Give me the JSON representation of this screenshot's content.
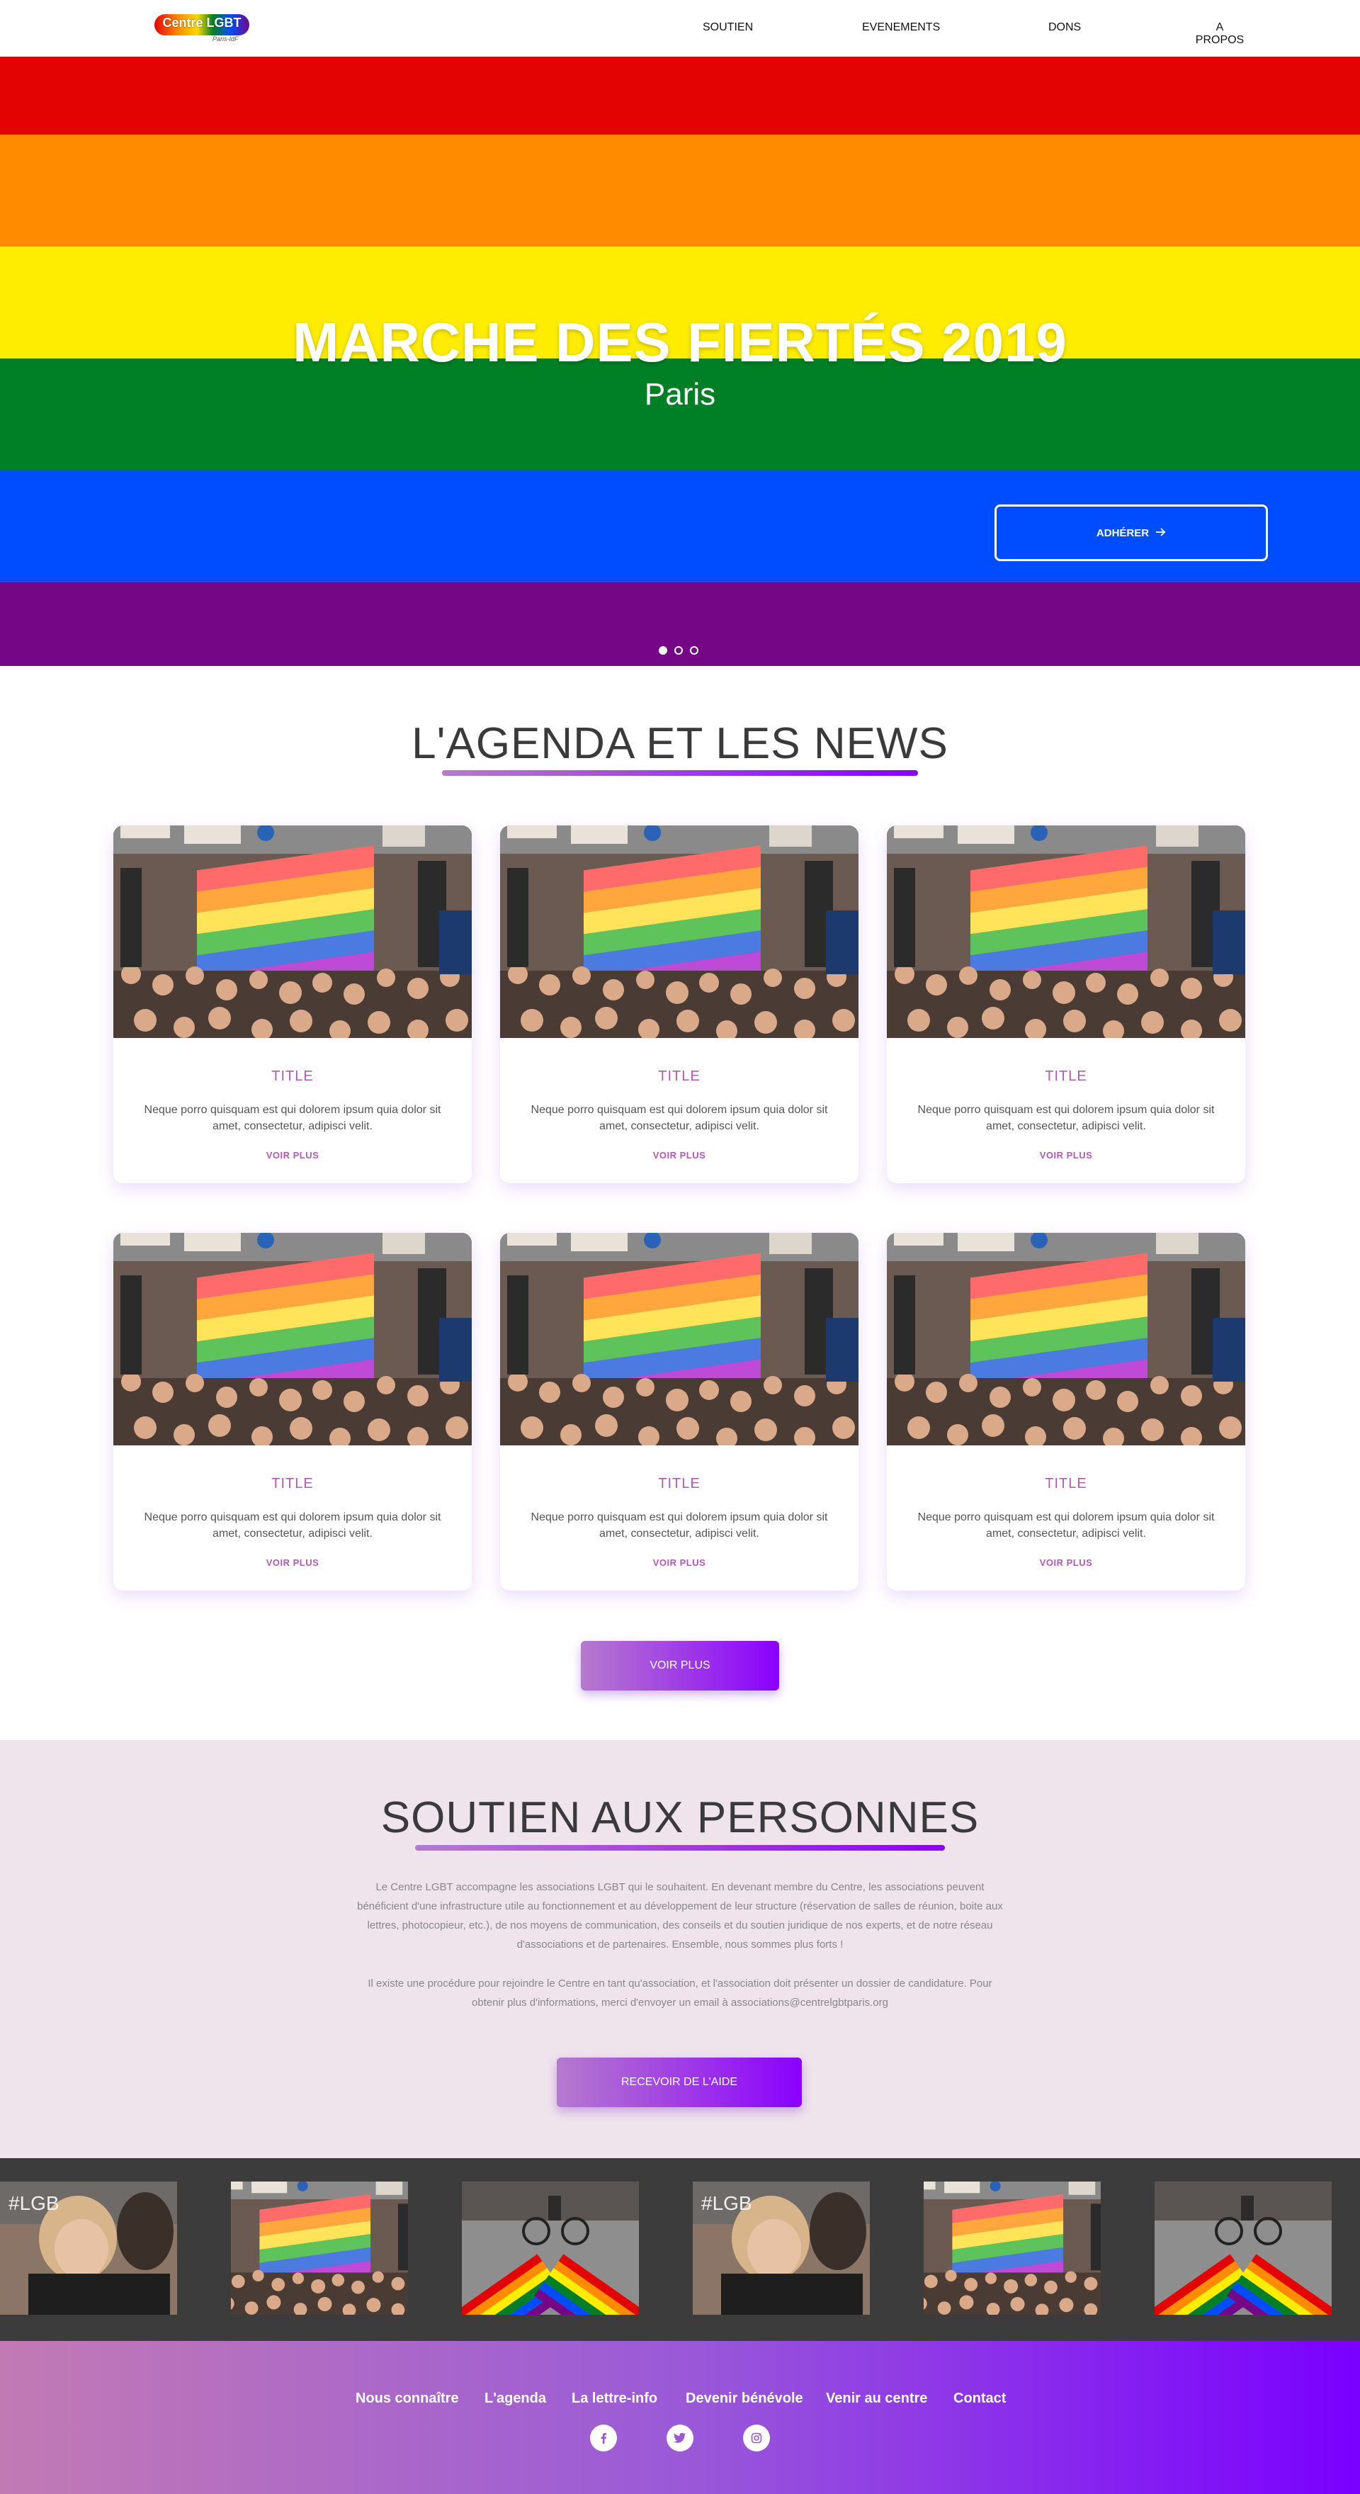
{
  "brand": {
    "logo_text": "Centre LGBT",
    "logo_sub": "Paris-IdF"
  },
  "nav": {
    "items": [
      "SOUTIEN",
      "EVENEMENTS",
      "DONS",
      "A PROPOS"
    ]
  },
  "hero": {
    "title": "MARCHE DES FIERTÉS 2019",
    "subtitle": "Paris",
    "cta_label": "ADHÉRER",
    "cta_icon": "arrow-right-icon",
    "stripe_colors": [
      "#e40303",
      "#ff8c00",
      "#ffed00",
      "#008026",
      "#004dff",
      "#750787"
    ],
    "active_slide": 1,
    "slide_count": 3
  },
  "agenda": {
    "title": "L'AGENDA ET LES NEWS",
    "cards": [
      {
        "title": "TITLE",
        "text": "Neque porro quisquam est qui dolorem ipsum quia dolor sit amet, consectetur, adipisci velit.",
        "link": "VOIR PLUS"
      },
      {
        "title": "TITLE",
        "text": "Neque porro quisquam est qui dolorem ipsum quia dolor sit amet, consectetur, adipisci velit.",
        "link": "VOIR PLUS"
      },
      {
        "title": "TITLE",
        "text": "Neque porro quisquam est qui dolorem ipsum quia dolor sit amet, consectetur, adipisci velit.",
        "link": "VOIR PLUS"
      },
      {
        "title": "TITLE",
        "text": "Neque porro quisquam est qui dolorem ipsum quia dolor sit amet, consectetur, adipisci velit.",
        "link": "VOIR PLUS"
      },
      {
        "title": "TITLE",
        "text": "Neque porro quisquam est qui dolorem ipsum quia dolor sit amet, consectetur, adipisci velit.",
        "link": "VOIR PLUS"
      },
      {
        "title": "TITLE",
        "text": "Neque porro quisquam est qui dolorem ipsum quia dolor sit amet, consectetur, adipisci velit.",
        "link": "VOIR PLUS"
      }
    ],
    "more_label": "VOIR PLUS"
  },
  "support": {
    "title": "SOUTIEN AUX PERSONNES",
    "paragraph1": "Le Centre LGBT accompagne les associations LGBT qui le souhaitent. En devenant membre du Centre, les associations peuvent bénéficient d'une infrastructure utile au fonctionnement et au développement de leur structure (réservation de salles de réunion, boite aux lettres, photocopieur, etc.), de nos moyens de communication, des conseils et du soutien juridique de nos experts, et de notre réseau d'associations et de partenaires. Ensemble, nous sommes plus forts !",
    "paragraph2": "Il existe une procédure pour rejoindre le Centre en tant qu'association, et l'association doit présenter un dossier de candidature. Pour obtenir plus d'informations, merci d'envoyer un email à associations@centrelgbtparis.org",
    "cta_label": "RECEVOIR DE L'AIDE"
  },
  "gallery": {
    "items": [
      "hugging-woman-photo",
      "pride-flag-crowd-photo",
      "rainbow-crosswalk-photo",
      "hugging-woman-photo",
      "pride-flag-crowd-photo",
      "rainbow-crosswalk-photo"
    ]
  },
  "footer": {
    "links": [
      "Nous connaître",
      "L'agenda",
      "La lettre-info",
      "Devenir bénévole",
      "Venir au centre",
      "Contact"
    ],
    "social": [
      "facebook-icon",
      "twitter-icon",
      "instagram-icon"
    ]
  },
  "colors": {
    "accent_start": "#b57bcd",
    "accent_end": "#8b00ff",
    "card_title": "#b05ab5",
    "support_bg": "#efe3ec",
    "gallery_bg": "#3c3c3c"
  }
}
